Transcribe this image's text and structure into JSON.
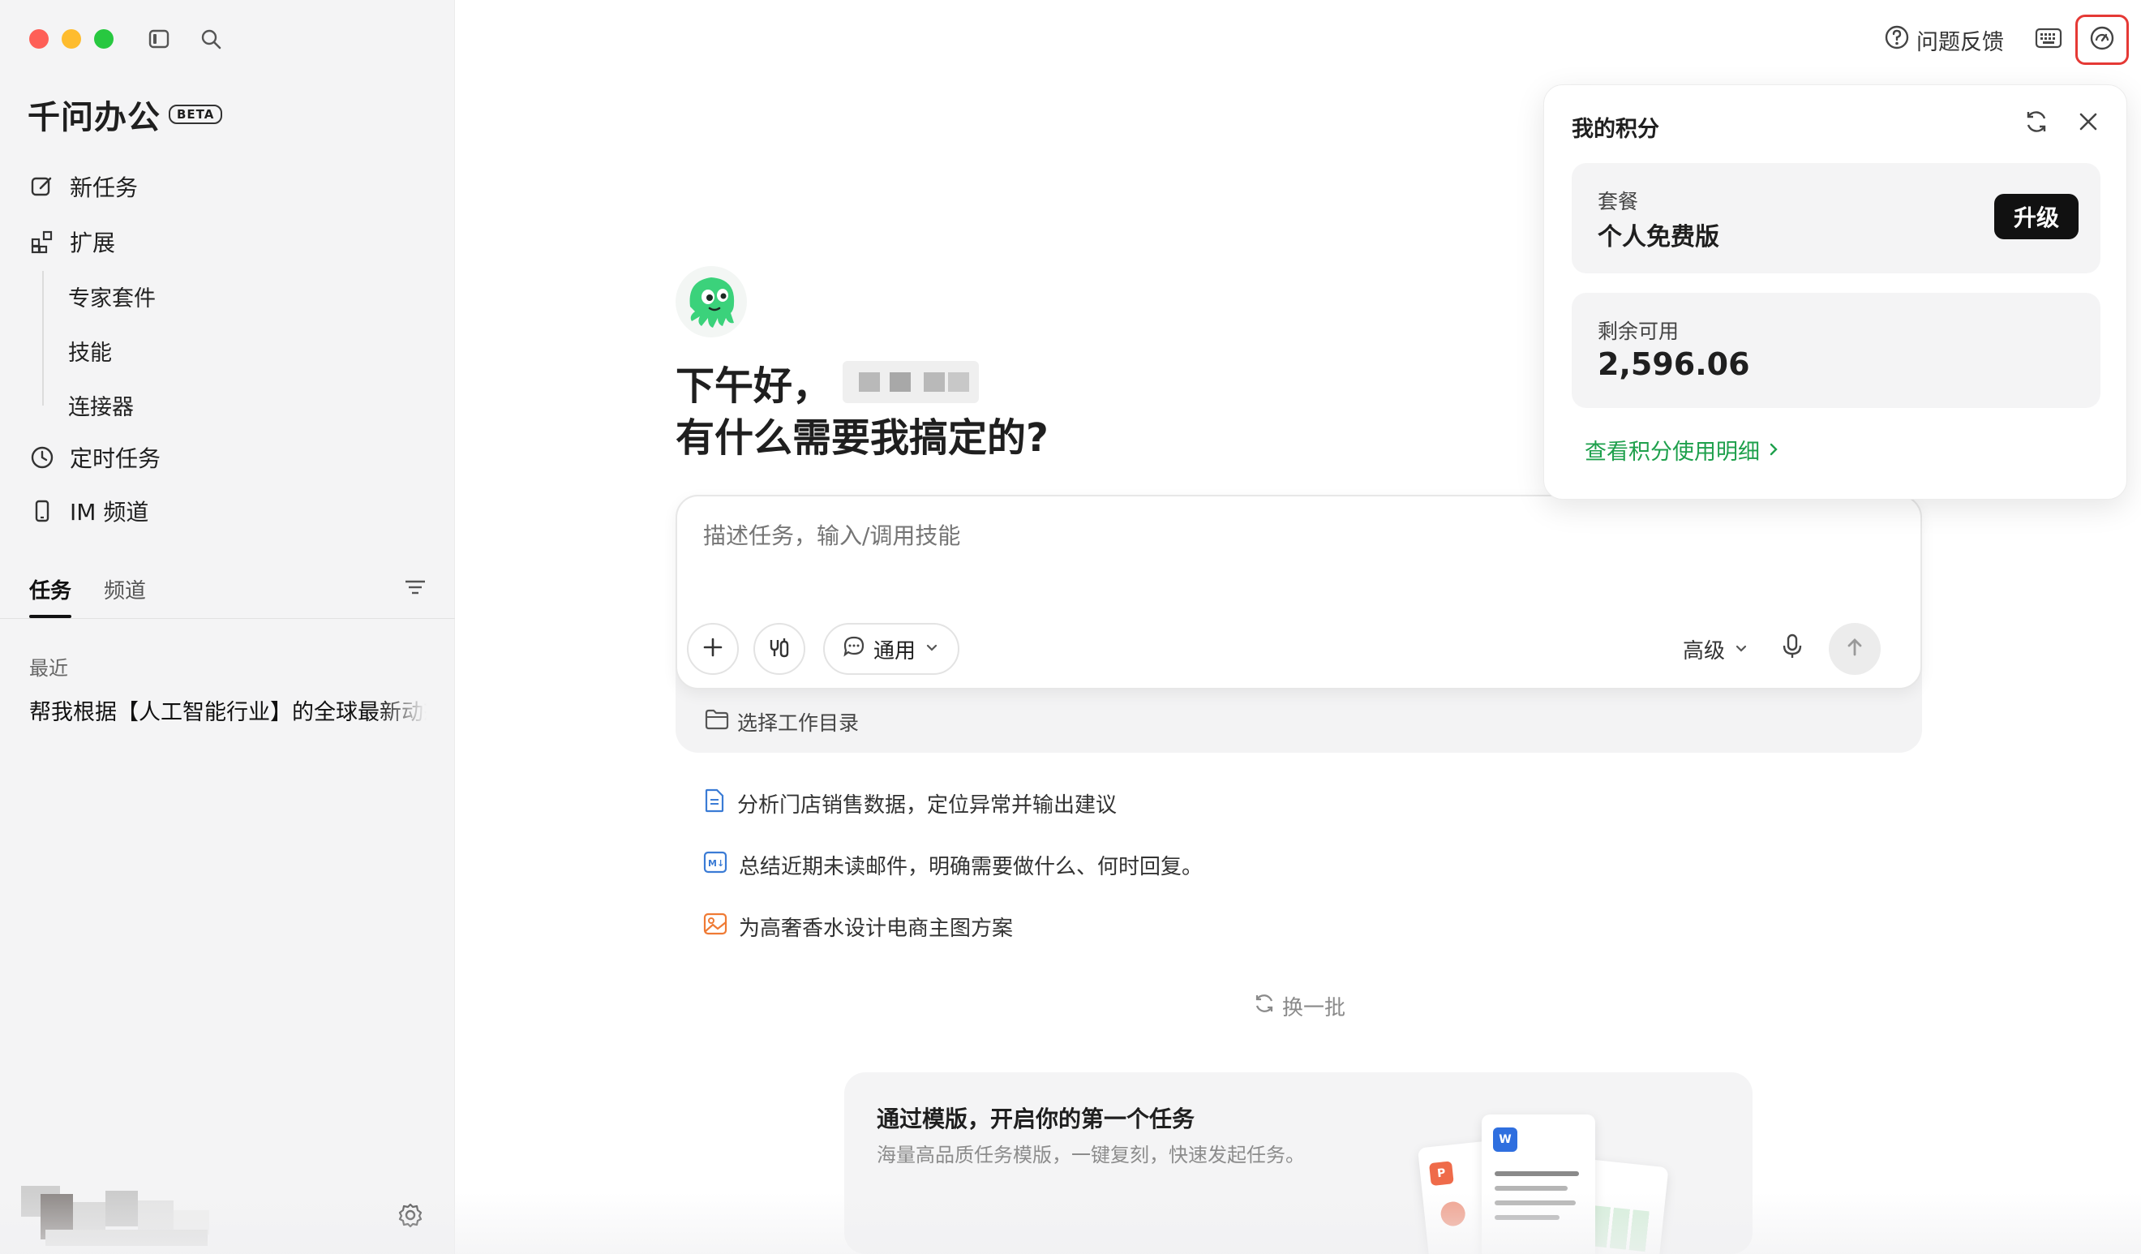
{
  "app": {
    "name": "千问办公",
    "badge": "BETA"
  },
  "colors": {
    "accent_green": "#1ea04c",
    "traffic_red": "#fe5f57",
    "traffic_yellow": "#febc2e",
    "traffic_green": "#28c840",
    "highlight_red": "#e53935"
  },
  "sidebar": {
    "nav": [
      {
        "label": "新任务",
        "icon": "edit-icon"
      },
      {
        "label": "扩展",
        "icon": "extensions-icon"
      },
      {
        "label": "定时任务",
        "icon": "clock-icon"
      },
      {
        "label": "IM 频道",
        "icon": "phone-icon"
      }
    ],
    "sub": [
      "专家套件",
      "技能",
      "连接器"
    ],
    "tabs": [
      "任务",
      "频道"
    ],
    "recent_label": "最近",
    "recent_items": [
      "帮我根据【人工智能行业】的全球最新动态"
    ]
  },
  "topbar": {
    "feedback": "问题反馈"
  },
  "greeting": {
    "line1": "下午好，",
    "line2": "有什么需要我搞定的?"
  },
  "input": {
    "placeholder": "描述任务，输入/调用技能",
    "mode": "通用",
    "advanced": "高级",
    "workdir": "选择工作目录"
  },
  "suggestions": [
    {
      "text": "分析门店销售数据，定位异常并输出建议",
      "icon": "document-icon"
    },
    {
      "text": "总结近期未读邮件，明确需要做什么、何时回复。",
      "icon": "markdown-icon"
    },
    {
      "text": "为高奢香水设计电商主图方案",
      "icon": "image-icon"
    }
  ],
  "refresh_label": "换一批",
  "template": {
    "title": "通过模版，开启你的第一个任务",
    "subtitle": "海量高品质任务模版，一键复刻，快速发起任务。"
  },
  "points_panel": {
    "title": "我的积分",
    "plan_label": "套餐",
    "plan_value": "个人免费版",
    "upgrade_label": "升级",
    "remaining_label": "剩余可用",
    "remaining_value": "2,596.06",
    "details_link": "查看积分使用明细"
  }
}
